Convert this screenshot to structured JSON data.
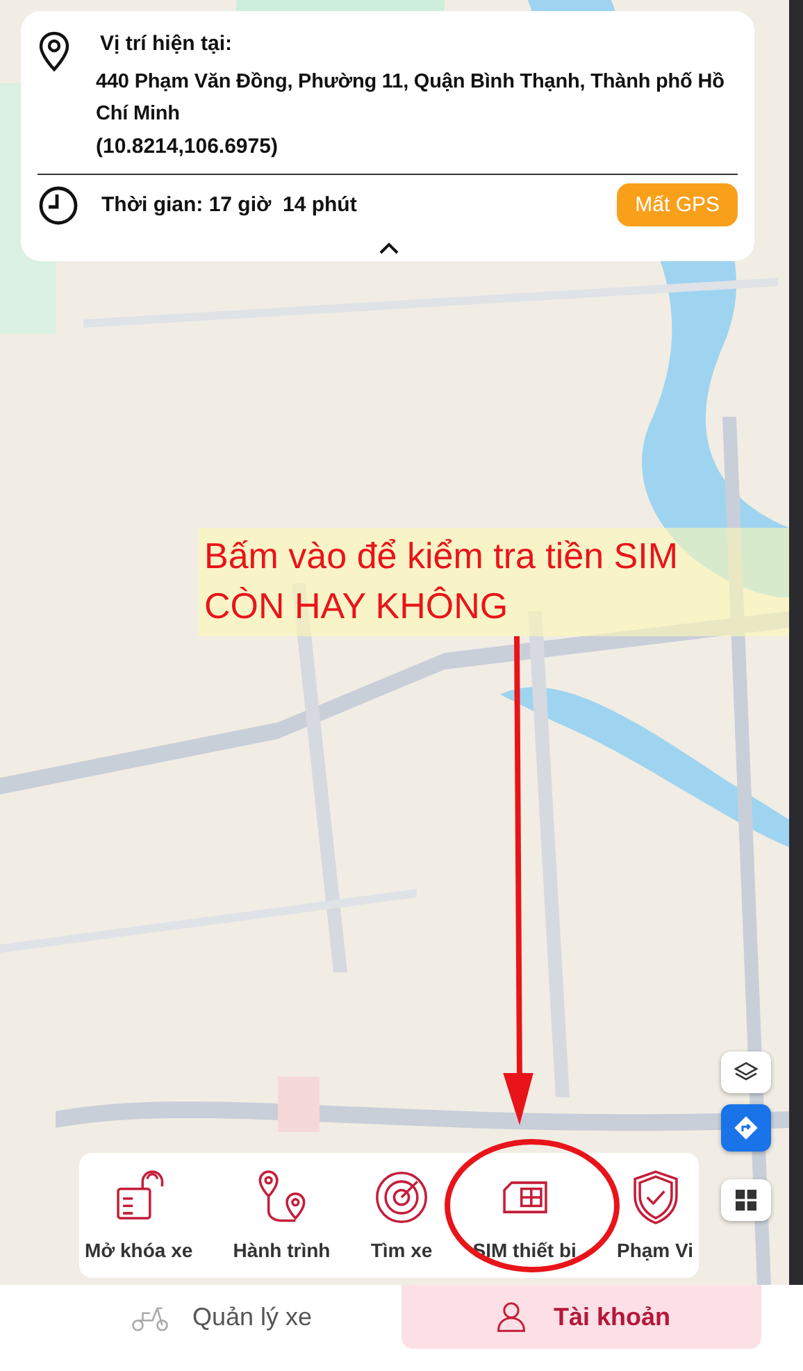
{
  "location": {
    "label": "Vị trí hiện tại:",
    "address": "440 Phạm Văn Đồng, Phường 11, Quận Bình Thạnh, Thành phố Hồ Chí Minh",
    "coords": "(10.8214,106.6975)"
  },
  "time": {
    "label": "Thời gian: 17 giờ  14 phút",
    "status": "Mất GPS"
  },
  "annotation": {
    "lines": [
      "Bấm vào để kiểm tra tiền SIM",
      "CÒN HAY KHÔNG"
    ]
  },
  "actions": [
    {
      "label": "Mở khóa xe",
      "kind": "unlock"
    },
    {
      "label": "Hành trình",
      "kind": "route"
    },
    {
      "label": "Tìm xe",
      "kind": "radar"
    },
    {
      "label": "SIM thiết bị",
      "kind": "sim"
    },
    {
      "label": "Phạm Vi",
      "kind": "shield"
    }
  ],
  "nav": [
    {
      "label": "Quản lý xe",
      "kind": "scooter",
      "selected": false
    },
    {
      "label": "Tài khoản",
      "kind": "person",
      "selected": true
    }
  ]
}
